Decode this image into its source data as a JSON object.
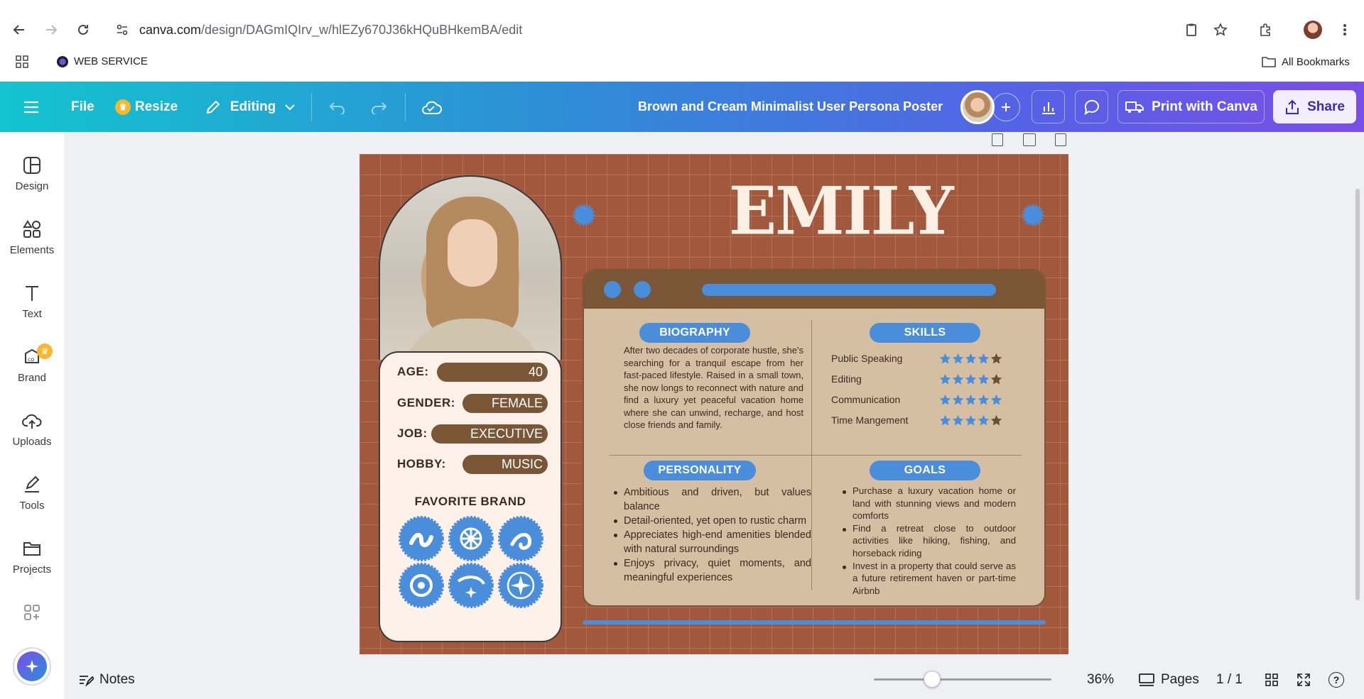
{
  "browser": {
    "url_host": "canva.com",
    "url_path": "/design/DAGmIQIrv_w/hlEZy670J36kHQuBHkemBA/edit",
    "bookmark": "WEB SERVICE",
    "all_bookmarks": "All Bookmarks"
  },
  "toolbar": {
    "file": "File",
    "resize": "Resize",
    "editing": "Editing",
    "doc_title": "Brown and Cream Minimalist User Persona Poster",
    "print": "Print with Canva",
    "share": "Share"
  },
  "sidebar": {
    "items": [
      {
        "label": "Design",
        "icon": "layout-icon"
      },
      {
        "label": "Elements",
        "icon": "shapes-icon"
      },
      {
        "label": "Text",
        "icon": "text-icon"
      },
      {
        "label": "Brand",
        "icon": "brand-icon"
      },
      {
        "label": "Uploads",
        "icon": "cloud-upload-icon"
      },
      {
        "label": "Tools",
        "icon": "pen-icon"
      },
      {
        "label": "Projects",
        "icon": "folder-icon"
      }
    ]
  },
  "design": {
    "name": "EMILY",
    "card": {
      "age_label": "AGE:",
      "age": "40",
      "gender_label": "GENDER:",
      "gender": "FEMALE",
      "job_label": "JOB:",
      "job": "EXECUTIVE",
      "hobby_label": "HOBBY:",
      "hobby": "MUSIC",
      "favorite_brand": "FAVORITE BRAND"
    },
    "biography": {
      "title": "BIOGRAPHY",
      "text": "After two decades of corporate hustle, she's searching for a tranquil escape from her fast-paced lifestyle. Raised in a small town, she now longs to reconnect with nature and find a luxury yet peaceful vacation home where she can unwind, recharge, and host close friends and family."
    },
    "skills": {
      "title": "SKILLS",
      "items": [
        {
          "name": "Public Speaking",
          "rating": 4
        },
        {
          "name": "Editing",
          "rating": 4
        },
        {
          "name": "Communication",
          "rating": 5
        },
        {
          "name": "Time Mangement",
          "rating": 4
        }
      ]
    },
    "personality": {
      "title": "PERSONALITY",
      "items": [
        "Ambitious and driven, but values balance",
        "Detail-oriented, yet open to rustic charm",
        "Appreciates high-end amenities blended with natural surroundings",
        "Enjoys privacy, quiet moments, and meaningful experiences"
      ]
    },
    "goals": {
      "title": "GOALS",
      "items": [
        "Purchase a luxury vacation home or land with stunning views and modern comforts",
        "Find a retreat close to outdoor activities like hiking, fishing, and horseback riding",
        "Invest in a property that could serve as a future retirement haven or part-time Airbnb"
      ]
    }
  },
  "bottom": {
    "notes": "Notes",
    "zoom_level": 36,
    "zoom": "36%",
    "pages": "Pages",
    "page_count": "1 / 1"
  },
  "colors": {
    "bg": "#a2583c",
    "accent_blue": "#4a8edb",
    "brown": "#7a5636",
    "cream": "#fdf1ea"
  }
}
